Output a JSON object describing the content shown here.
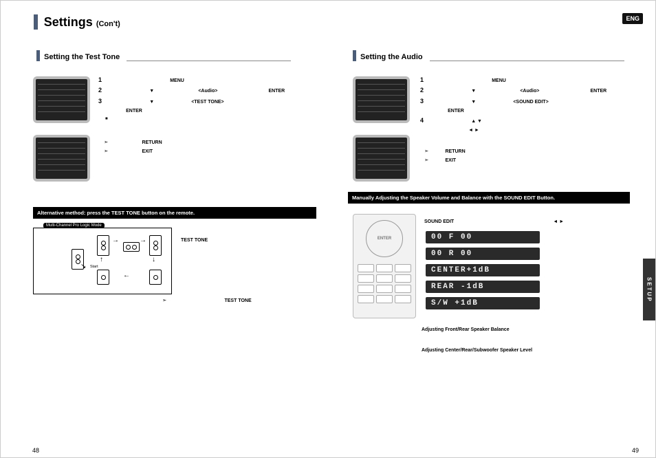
{
  "header": {
    "title": "Settings",
    "subtitle": "(Con't)"
  },
  "lang_badge": "ENG",
  "setup_tab": "SETUP",
  "page_left": "48",
  "page_right": "49",
  "left": {
    "section_title": "Setting the Test Tone",
    "steps": {
      "n1": "1",
      "s1_kw_menu": "MENU",
      "n2": "2",
      "s2_tri": "▼",
      "s2_audio": "<Audio>",
      "s2_enter": "ENTER",
      "n3": "3",
      "s3_tri": "▼",
      "s3_tag": "<TEST TONE>",
      "s3_enter_line": "ENTER",
      "s3_square": "■"
    },
    "return_exit": {
      "return_arrow": "➣",
      "return": "RETURN",
      "exit_arrow": "➣",
      "exit": "EXIT"
    },
    "info_box": "Alternative method: press the TEST TONE button on the remote.",
    "diagram_label": "Multi-Channel Pro Logic Mode",
    "diagram_start": "Start",
    "diag_right_label": "TEST TONE",
    "bottom_arrow": "➣",
    "bottom_label": "TEST TONE"
  },
  "right": {
    "section_title": "Setting the Audio",
    "steps": {
      "n1": "1",
      "s1_kw_menu": "MENU",
      "n2": "2",
      "s2_tri": "▼",
      "s2_audio": "<Audio>",
      "s2_enter": "ENTER",
      "n3": "3",
      "s3_tri": "▼",
      "s3_tag": "<SOUND EDIT>",
      "s3_enter_line": "ENTER",
      "n4": "4",
      "s4_tri_ud": "▲ ▼",
      "s4_tri_lr": "◄ ►"
    },
    "return_exit": {
      "return_arrow": "➣",
      "return": "RETURN",
      "exit_arrow": "➣",
      "exit": "EXIT"
    },
    "info_box": "Manually Adjusting the Speaker Volume and Balance with the SOUND EDIT Button.",
    "sound_edit_label": "SOUND EDIT",
    "sound_edit_arrows": "◄ ►",
    "lcd": {
      "r1": "00 F  00",
      "r2": "00 R  00",
      "r3": "CENTER+1dB",
      "r4": "REAR  -1dB",
      "r5": "S/W   +1dB"
    },
    "adj1": "Adjusting Front/Rear Speaker Balance",
    "adj2": "Adjusting Center/Rear/Subwoofer Speaker Level"
  }
}
